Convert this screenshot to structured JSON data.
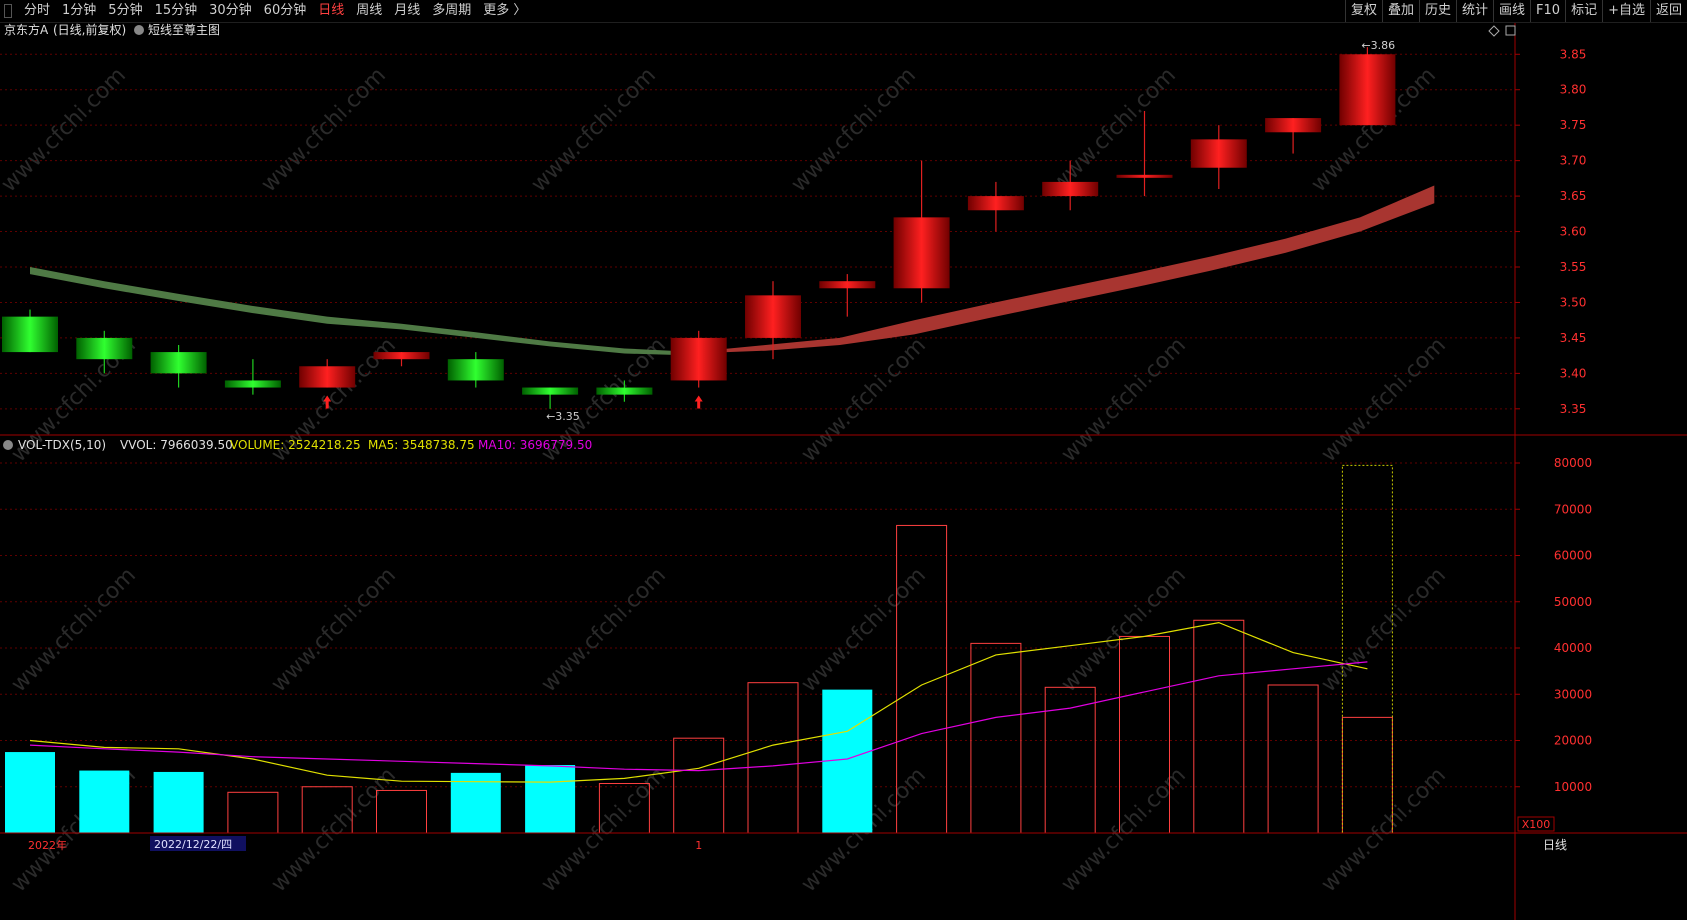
{
  "toolbar": {
    "periods": [
      "分时",
      "1分钟",
      "5分钟",
      "15分钟",
      "30分钟",
      "60分钟",
      "日线",
      "周线",
      "月线",
      "多周期",
      "更多 〉"
    ],
    "active_period": "日线",
    "tools": [
      "复权",
      "叠加",
      "历史",
      "统计",
      "画线",
      "F10",
      "标记",
      "+自选",
      "返回"
    ]
  },
  "header": {
    "stock": "京东方A",
    "period_note": "(日线,前复权)",
    "indicator": "短线至尊主图",
    "min_label": "←3.35",
    "max_label": "←3.86",
    "right_icons": [
      "diamond-icon",
      "square-icon"
    ]
  },
  "volume_header": {
    "name": "VOL-TDX(5,10)",
    "vvol": "VVOL: 7966039.50",
    "volume": "VOLUME: 2524218.25",
    "ma5": "MA5: 3548738.75",
    "ma10": "MA10: 3696779.50"
  },
  "axis": {
    "price_ticks": [
      "3.85",
      "3.80",
      "3.75",
      "3.70",
      "3.65",
      "3.60",
      "3.55",
      "3.50",
      "3.45",
      "3.40",
      "3.35"
    ],
    "volume_ticks": [
      "80000",
      "70000",
      "60000",
      "50000",
      "40000",
      "30000",
      "20000",
      "10000"
    ],
    "volume_unit": "X100",
    "x_labels": [
      "2022年",
      "2022/12/22/四",
      "1"
    ],
    "period_corner": "日线"
  },
  "colors": {
    "up": "#e00000",
    "down": "#00c000",
    "vol_up": "#ff4040",
    "vol_down": "#00ffff",
    "ma5": "#e0e000",
    "ma10": "#e000e0",
    "grid": "#600000",
    "axis": "#a00000"
  },
  "chart_data": {
    "type": "candlestick",
    "candles": [
      {
        "o": 3.48,
        "c": 3.43,
        "h": 3.49,
        "l": 3.43
      },
      {
        "o": 3.45,
        "c": 3.42,
        "h": 3.46,
        "l": 3.4
      },
      {
        "o": 3.43,
        "c": 3.4,
        "h": 3.44,
        "l": 3.38
      },
      {
        "o": 3.39,
        "c": 3.38,
        "h": 3.42,
        "l": 3.37
      },
      {
        "o": 3.38,
        "c": 3.41,
        "h": 3.42,
        "l": 3.38
      },
      {
        "o": 3.42,
        "c": 3.43,
        "h": 3.43,
        "l": 3.41
      },
      {
        "o": 3.42,
        "c": 3.39,
        "h": 3.43,
        "l": 3.38
      },
      {
        "o": 3.38,
        "c": 3.37,
        "h": 3.38,
        "l": 3.35
      },
      {
        "o": 3.38,
        "c": 3.37,
        "h": 3.39,
        "l": 3.36
      },
      {
        "o": 3.39,
        "c": 3.45,
        "h": 3.46,
        "l": 3.38
      },
      {
        "o": 3.45,
        "c": 3.51,
        "h": 3.53,
        "l": 3.42
      },
      {
        "o": 3.52,
        "c": 3.53,
        "h": 3.54,
        "l": 3.48
      },
      {
        "o": 3.52,
        "c": 3.62,
        "h": 3.7,
        "l": 3.5
      },
      {
        "o": 3.63,
        "c": 3.65,
        "h": 3.67,
        "l": 3.6
      },
      {
        "o": 3.65,
        "c": 3.67,
        "h": 3.7,
        "l": 3.63
      },
      {
        "o": 3.68,
        "c": 3.68,
        "h": 3.77,
        "l": 3.65
      },
      {
        "o": 3.69,
        "c": 3.73,
        "h": 3.75,
        "l": 3.66
      },
      {
        "o": 3.74,
        "c": 3.76,
        "h": 3.76,
        "l": 3.71
      },
      {
        "o": 3.75,
        "c": 3.85,
        "h": 3.86,
        "l": 3.75
      }
    ],
    "band_down": [
      [
        3.55,
        3.54
      ],
      [
        3.53,
        3.52
      ],
      [
        3.512,
        3.502
      ],
      [
        3.495,
        3.485
      ],
      [
        3.48,
        3.47
      ],
      [
        3.47,
        3.462
      ],
      [
        3.458,
        3.45
      ],
      [
        3.445,
        3.438
      ],
      [
        3.435,
        3.428
      ],
      [
        3.43,
        3.425
      ]
    ],
    "band_up": [
      [
        3.43,
        3.428
      ],
      [
        3.44,
        3.432
      ],
      [
        3.45,
        3.44
      ],
      [
        3.475,
        3.455
      ],
      [
        3.498,
        3.478
      ],
      [
        3.52,
        3.5
      ],
      [
        3.542,
        3.522
      ],
      [
        3.565,
        3.545
      ],
      [
        3.59,
        3.57
      ],
      [
        3.62,
        3.6
      ],
      [
        3.665,
        3.64
      ]
    ],
    "signals": [
      4,
      9
    ],
    "volume": [
      {
        "v": 17500,
        "up": false
      },
      {
        "v": 13500,
        "up": false
      },
      {
        "v": 13200,
        "up": false
      },
      {
        "v": 8800,
        "up": true
      },
      {
        "v": 10000,
        "up": true
      },
      {
        "v": 9200,
        "up": true
      },
      {
        "v": 13000,
        "up": false
      },
      {
        "v": 14700,
        "up": false
      },
      {
        "v": 10700,
        "up": true
      },
      {
        "v": 20500,
        "up": true
      },
      {
        "v": 32500,
        "up": true
      },
      {
        "v": 31000,
        "up": false
      },
      {
        "v": 66500,
        "up": true
      },
      {
        "v": 41000,
        "up": true
      },
      {
        "v": 31500,
        "up": true
      },
      {
        "v": 42500,
        "up": true
      },
      {
        "v": 46000,
        "up": true
      },
      {
        "v": 32000,
        "up": true
      },
      {
        "v": 25000,
        "up": true
      }
    ],
    "volume_forecast": 79500,
    "ma5": [
      20000,
      18500,
      18200,
      16000,
      12500,
      11200,
      11100,
      11000,
      11800,
      14000,
      19000,
      22000,
      32000,
      38500,
      40500,
      42500,
      45500,
      39000,
      35500
    ],
    "ma10": [
      19000,
      18200,
      17500,
      16500,
      16000,
      15500,
      15000,
      14500,
      13800,
      13500,
      14500,
      16000,
      21500,
      25000,
      27000,
      30500,
      34000,
      35500,
      37000
    ],
    "price_range": [
      3.33,
      3.88
    ],
    "volume_range": [
      0,
      80000
    ]
  }
}
